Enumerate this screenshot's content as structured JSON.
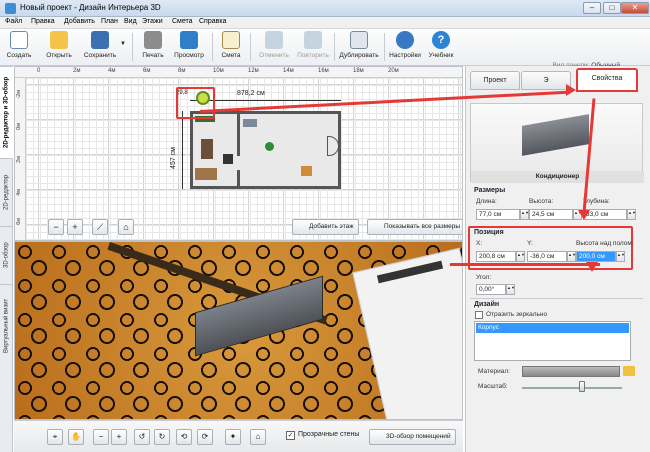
{
  "window": {
    "title": "Новый проект - Дизайн Интерьера 3D"
  },
  "menu": {
    "items": [
      "Файл",
      "Правка",
      "Добавить",
      "План",
      "Вид",
      "Этажи",
      "Смета",
      "Справка"
    ]
  },
  "toolbar": {
    "create": "Создать",
    "open": "Открыть",
    "save": "Сохранить",
    "print": "Печать",
    "preview": "Просмотр",
    "estimate": "Смета",
    "undo": "Отменить",
    "redo": "Повторить",
    "duplicate": "Дублировать",
    "settings": "Настройки",
    "tutorial": "Учебник",
    "panel_view_label": "Вид панели:",
    "panel_view_value": "Обычный"
  },
  "left_tabs": {
    "t1": "2D-редактор и 3D-обзор",
    "t2": "2D-редактор",
    "t3": "3D-обзор",
    "t4": "Виртуальный визит"
  },
  "editor2d": {
    "ruler_top": [
      "0",
      "2м",
      "4м",
      "6м",
      "8м",
      "10м",
      "12м",
      "14м",
      "16м",
      "18м",
      "20м"
    ],
    "ruler_left": [
      "-2м",
      "0м",
      "2м",
      "4м",
      "6м",
      "8м"
    ],
    "dim_width": "878,2 см",
    "dim_height": "457 см",
    "dim_small": "29,8",
    "add_floor": "Добавить этаж",
    "show_sizes": "Показывать все размеры"
  },
  "bottom": {
    "transparent_walls": "Прозрачные стены",
    "overview": "3D-обзор помещений"
  },
  "right_panel": {
    "tab_project": "Проект",
    "tab_object": "Э",
    "tab_properties": "Свойства",
    "preview_caption": "Кондиционер",
    "sizes_title": "Размеры",
    "length_label": "Длина:",
    "length_value": "77,0 см",
    "height_label": "Высота:",
    "height_value": "24,5 см",
    "depth_label": "Глубина:",
    "depth_value": "33,0 см",
    "position_title": "Позиция",
    "x_label": "X:",
    "x_value": "200,8 см",
    "y_label": "Y:",
    "y_value": "-36,0 см",
    "floor_label": "Высота над полом:",
    "floor_value": "200,0 см",
    "angle_label": "Угол:",
    "angle_value": "0,00°",
    "design_title": "Дизайн",
    "mirror_label": "Отразить зеркально",
    "list_item": "Корпус",
    "material_label": "Материал:",
    "scale_label": "Масштаб:"
  },
  "colors": {
    "accent_red": "#e53935",
    "selection_blue": "#3399ff"
  }
}
